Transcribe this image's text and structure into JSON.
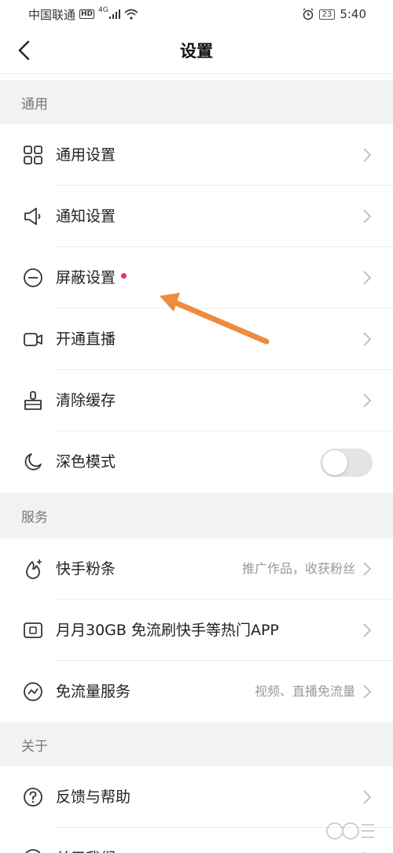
{
  "status_bar": {
    "carrier": "中国联通",
    "hd": "HD",
    "network": "4G",
    "battery": "23",
    "time": "5:40"
  },
  "nav": {
    "title": "设置"
  },
  "sections": {
    "general": {
      "title": "通用"
    },
    "services": {
      "title": "服务"
    },
    "about": {
      "title": "关于"
    }
  },
  "items": {
    "general_settings": {
      "label": "通用设置"
    },
    "notification_settings": {
      "label": "通知设置"
    },
    "block_settings": {
      "label": "屏蔽设置"
    },
    "live_stream": {
      "label": "开通直播"
    },
    "clear_cache": {
      "label": "清除缓存"
    },
    "dark_mode": {
      "label": "深色模式",
      "enabled": false
    },
    "kuaishou_fans": {
      "label": "快手粉条",
      "sub": "推广作品，收获粉丝"
    },
    "free_data_30gb": {
      "label": "月月30GB 免流刷快手等热门APP"
    },
    "free_data_service": {
      "label": "免流量服务",
      "sub": "视频、直播免流量"
    },
    "feedback_help": {
      "label": "反馈与帮助"
    },
    "about_us": {
      "label": "关于我们"
    }
  },
  "colors": {
    "accent_dot": "#e8336b",
    "annotation_arrow": "#f08a3c",
    "section_bg": "#f2f2f2"
  }
}
